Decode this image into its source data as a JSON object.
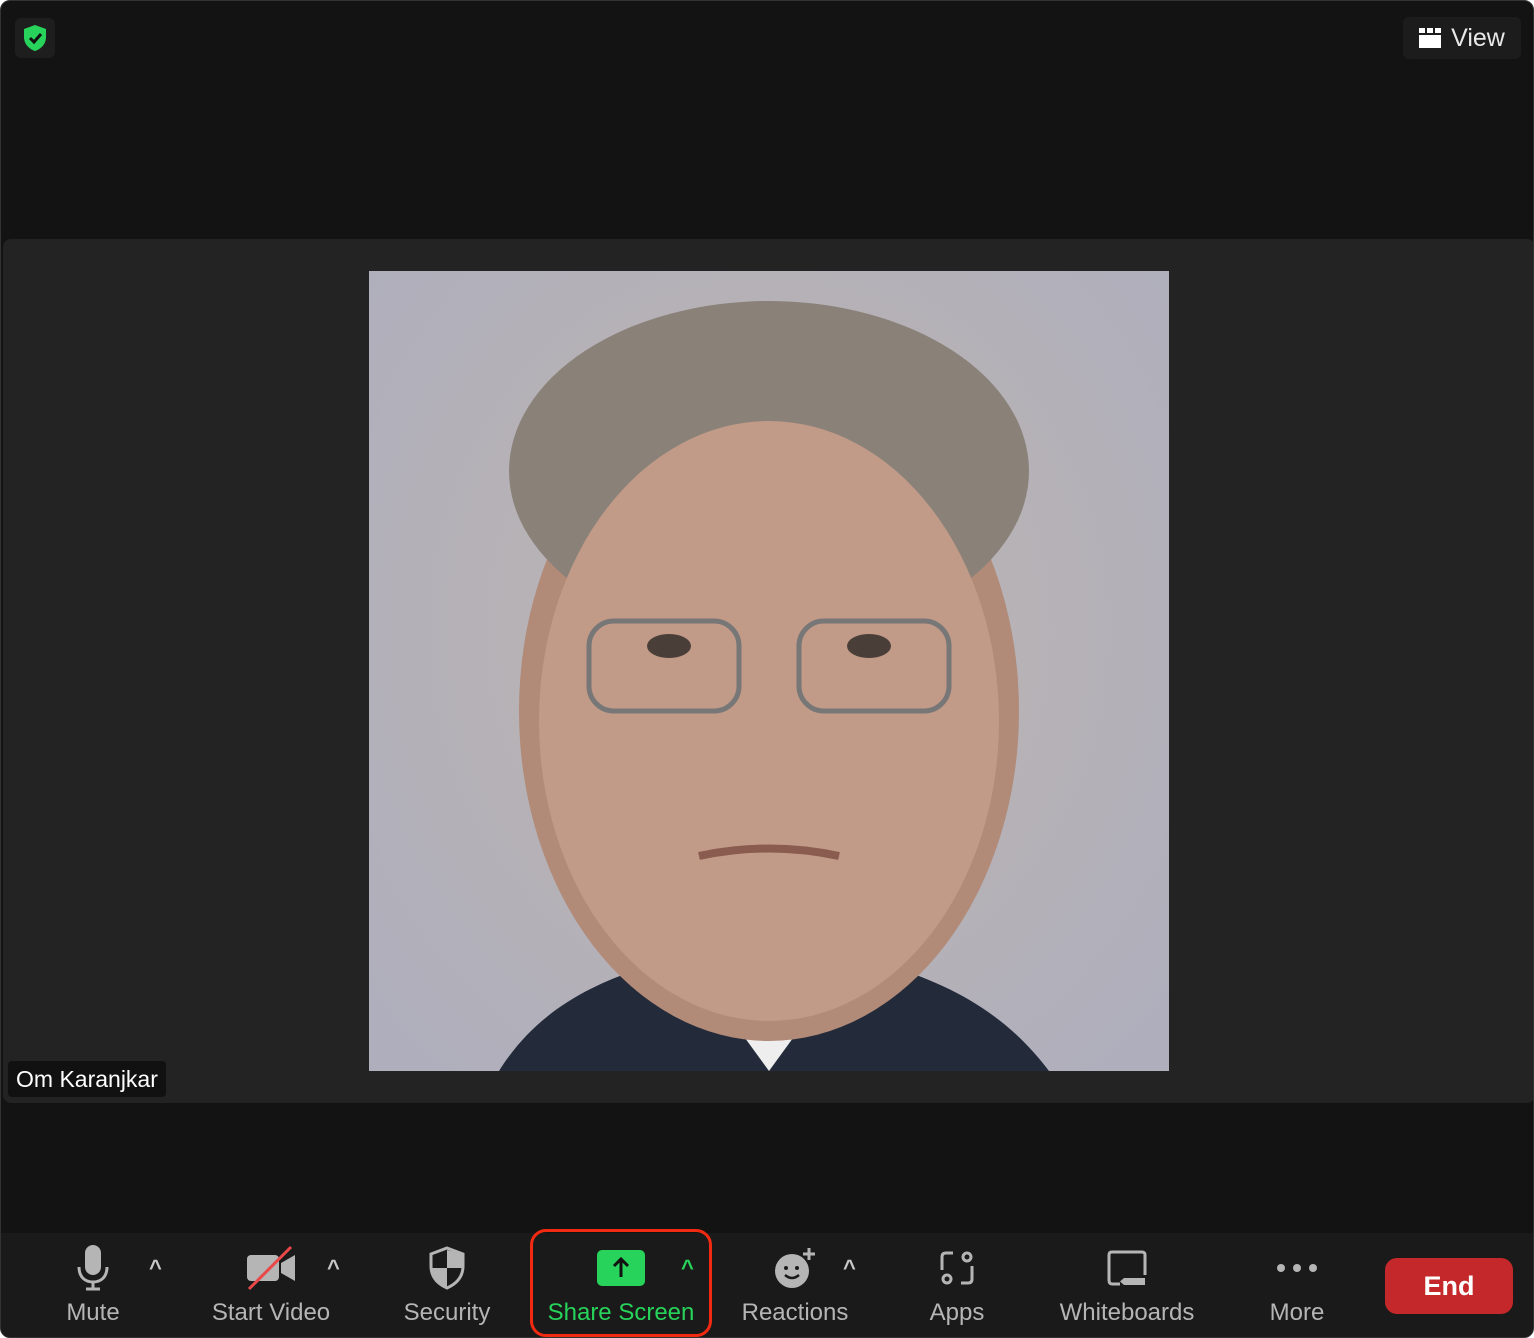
{
  "header": {
    "view_label": "View",
    "security_icon": "shield-check-icon",
    "security_color": "#27d35a"
  },
  "participant": {
    "name": "Om Karanjkar"
  },
  "toolbar": {
    "mute": "Mute",
    "start_video": "Start Video",
    "security": "Security",
    "share_screen": "Share Screen",
    "reactions": "Reactions",
    "apps": "Apps",
    "whiteboards": "Whiteboards",
    "more": "More",
    "end": "End",
    "caret": "^"
  },
  "colors": {
    "accent": "#27d35a",
    "end": "#c4282a",
    "highlight": "#f22a12"
  }
}
